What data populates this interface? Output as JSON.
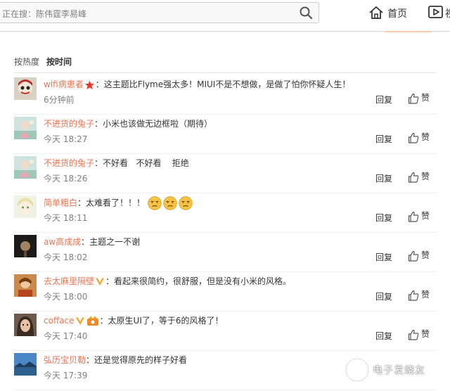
{
  "search": {
    "text": "正在搜：陈伟霆李易峰"
  },
  "nav": {
    "home_label": "首页",
    "video_label": "视"
  },
  "sort": {
    "hot": "按热度",
    "time": "按时间"
  },
  "actions": {
    "reply": "回复",
    "like": "赞"
  },
  "comments": [
    {
      "user": "wifi病患者",
      "text": "：这主题比Flyme强太多！MIUI不是不想做，是做了怕你怀疑人生！",
      "time": "6分钟前"
    },
    {
      "user": "不进货的兔子",
      "text": "：小米也该做无边框啦（期待）",
      "time": "今天 18:27"
    },
    {
      "user": "不进货的兔子",
      "text": "：不好看   不好看    拒绝",
      "time": "今天 18:26"
    },
    {
      "user": "简单粗白",
      "text": "：太难看了！！！",
      "time": "今天 18:11"
    },
    {
      "user": "aw高成成",
      "text": "：主题之一不谢",
      "time": "今天 18:02"
    },
    {
      "user": "去太麻里隔壁",
      "text": "：看起来很简约，很舒服，但是没有小米的风格。",
      "time": "今天 18:00"
    },
    {
      "user": "cofface",
      "text": "：太原生UI了，等于6的风格了！",
      "time": "今天 17:40"
    },
    {
      "user": "弘历宝贝勒",
      "text": "：还是觉得原先的样子好看",
      "time": "今天 17:39"
    }
  ],
  "watermark": {
    "text": "电子发烧友"
  },
  "colors": {
    "username": "#eb7350",
    "star_badge": "#e8382e",
    "verified_badge": "#f5a623",
    "emoji": "#f6c343"
  }
}
